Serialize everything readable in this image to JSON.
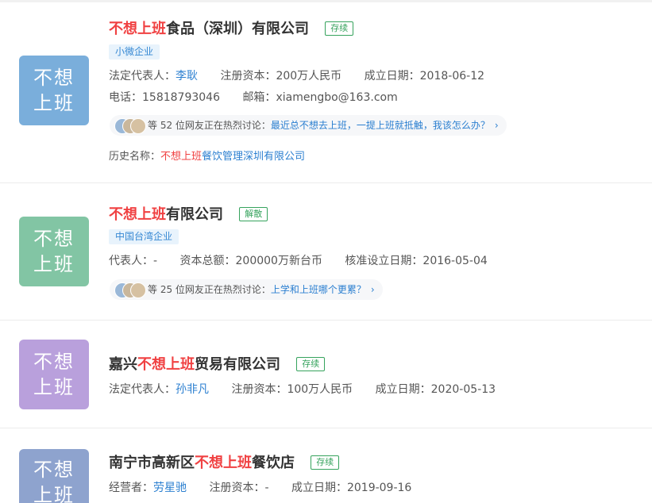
{
  "results": [
    {
      "logo_line1": "不想",
      "logo_line2": "上班",
      "logo_color": "#7aaedb",
      "name_pre": "",
      "name_hl": "不想上班",
      "name_post": "食品（深圳）有限公司",
      "status": "存续",
      "tag": "小微企业",
      "row1": [
        {
          "label": "法定代表人：",
          "value": "李耿"
        },
        {
          "label": "注册资本：",
          "value": "200万人民币"
        },
        {
          "label": "成立日期：",
          "value": "2018-06-12"
        }
      ],
      "row2": [
        {
          "label": "电话：",
          "value": "15818793046"
        },
        {
          "label": "邮箱：",
          "value": "xiamengbo@163.com"
        }
      ],
      "discussion_prefix": "等 52 位网友正在热烈讨论：",
      "discussion_question": "最近总不想去上班，一提上班就抵触，我该怎么办？",
      "history_label": "历史名称：",
      "history_hl": "不想上班",
      "history_rest": "餐饮管理深圳有限公司"
    },
    {
      "logo_line1": "不想",
      "logo_line2": "上班",
      "logo_color": "#82c5a4",
      "name_pre": "",
      "name_hl": "不想上班",
      "name_post": "有限公司",
      "status": "解散",
      "tag": "中国台湾企业",
      "row1": [
        {
          "label": "代表人：",
          "value": "-"
        },
        {
          "label": "资本总额：",
          "value": "200000万新台币"
        },
        {
          "label": "核准设立日期：",
          "value": "2016-05-04"
        }
      ],
      "discussion_prefix": "等 25 位网友正在热烈讨论：",
      "discussion_question": "上学和上班哪个更累？"
    },
    {
      "logo_line1": "不想",
      "logo_line2": "上班",
      "logo_color": "#b9a0dc",
      "name_pre": "嘉兴",
      "name_hl": "不想上班",
      "name_post": "贸易有限公司",
      "status": "存续",
      "row1": [
        {
          "label": "法定代表人：",
          "value": "孙非凡"
        },
        {
          "label": "注册资本：",
          "value": "100万人民币"
        },
        {
          "label": "成立日期：",
          "value": "2020-05-13"
        }
      ]
    },
    {
      "logo_line1": "不想",
      "logo_line2": "上班",
      "logo_color": "#8ea3ce",
      "name_pre": "南宁市高新区",
      "name_hl": "不想上班",
      "name_post": "餐饮店",
      "status": "存续",
      "row1": [
        {
          "label": "经营者：",
          "value": "劳星驰"
        },
        {
          "label": "注册资本：",
          "value": "-"
        },
        {
          "label": "成立日期：",
          "value": "2019-09-16"
        }
      ]
    }
  ],
  "icons": {
    "discussion_avatars": "user-avatars-icon",
    "chevron": "chevron-right-icon"
  }
}
